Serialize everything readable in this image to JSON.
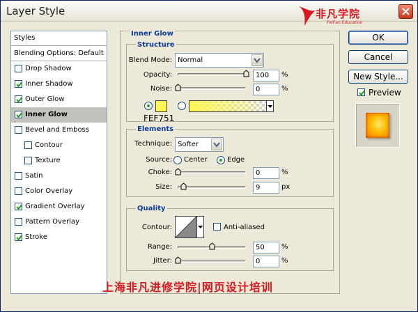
{
  "window": {
    "title": "Layer Style"
  },
  "logo": {
    "text": "非凡学院",
    "subtext": "FeiFan Education",
    "color": "#d71820"
  },
  "styles_panel": {
    "header": "Styles",
    "blending_options": "Blending Options: Default",
    "items": [
      {
        "label": "Drop Shadow",
        "checked": false,
        "sub": false,
        "selected": false
      },
      {
        "label": "Inner Shadow",
        "checked": true,
        "sub": false,
        "selected": false
      },
      {
        "label": "Outer Glow",
        "checked": true,
        "sub": false,
        "selected": false
      },
      {
        "label": "Inner Glow",
        "checked": true,
        "sub": false,
        "selected": true
      },
      {
        "label": "Bevel and Emboss",
        "checked": false,
        "sub": false,
        "selected": false
      },
      {
        "label": "Contour",
        "checked": false,
        "sub": true,
        "selected": false
      },
      {
        "label": "Texture",
        "checked": false,
        "sub": true,
        "selected": false
      },
      {
        "label": "Satin",
        "checked": false,
        "sub": false,
        "selected": false
      },
      {
        "label": "Color Overlay",
        "checked": false,
        "sub": false,
        "selected": false
      },
      {
        "label": "Gradient Overlay",
        "checked": true,
        "sub": false,
        "selected": false
      },
      {
        "label": "Pattern Overlay",
        "checked": false,
        "sub": false,
        "selected": false
      },
      {
        "label": "Stroke",
        "checked": true,
        "sub": false,
        "selected": false
      }
    ]
  },
  "inner_glow": {
    "title": "Inner Glow",
    "structure": {
      "title": "Structure",
      "blend_mode_label": "Blend Mode:",
      "blend_mode_value": "Normal",
      "opacity_label": "Opacity:",
      "opacity_value": "100",
      "opacity_unit": "%",
      "opacity_level": 1.0,
      "noise_label": "Noise:",
      "noise_value": "0",
      "noise_unit": "%",
      "noise_level": 0.0,
      "glow_color": "#FEF751",
      "hex_label": "FEF751"
    },
    "elements": {
      "title": "Elements",
      "technique_label": "Technique:",
      "technique_value": "Softer",
      "source_label": "Source:",
      "source_center": "Center",
      "source_edge": "Edge",
      "choke_label": "Choke:",
      "choke_value": "0",
      "choke_unit": "%",
      "choke_level": 0.0,
      "size_label": "Size:",
      "size_value": "9",
      "size_unit": "px",
      "size_level": 0.04
    },
    "quality": {
      "title": "Quality",
      "contour_label": "Contour:",
      "anti_aliased_label": "Anti-aliased",
      "range_label": "Range:",
      "range_value": "50",
      "range_unit": "%",
      "range_level": 0.5,
      "jitter_label": "Jitter:",
      "jitter_value": "0",
      "jitter_unit": "%",
      "jitter_level": 0.0
    }
  },
  "buttons": {
    "ok": "OK",
    "cancel": "Cancel",
    "new_style": "New Style..."
  },
  "preview": {
    "label": "Preview",
    "checked": true
  },
  "footer": {
    "text": "上海非凡进修学院|网页设计培训",
    "color": "#d71820"
  }
}
